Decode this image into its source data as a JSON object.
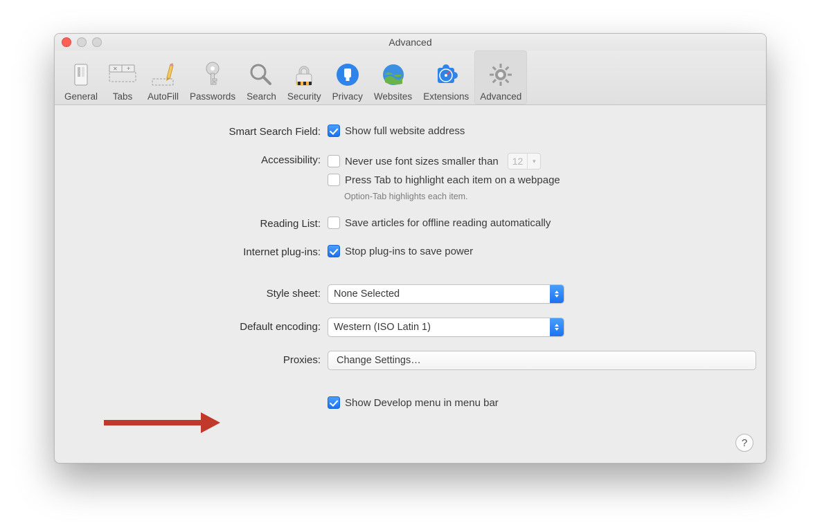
{
  "window": {
    "title": "Advanced"
  },
  "toolbar": {
    "items": [
      {
        "label": "General"
      },
      {
        "label": "Tabs"
      },
      {
        "label": "AutoFill"
      },
      {
        "label": "Passwords"
      },
      {
        "label": "Search"
      },
      {
        "label": "Security"
      },
      {
        "label": "Privacy"
      },
      {
        "label": "Websites"
      },
      {
        "label": "Extensions"
      },
      {
        "label": "Advanced"
      }
    ],
    "selected_index": 9
  },
  "sections": {
    "smart_search": {
      "label": "Smart Search Field:",
      "show_full_url": {
        "text": "Show full website address",
        "checked": true
      }
    },
    "accessibility": {
      "label": "Accessibility:",
      "min_font": {
        "text": "Never use font sizes smaller than",
        "checked": false,
        "value": "12"
      },
      "press_tab": {
        "text": "Press Tab to highlight each item on a webpage",
        "checked": false
      },
      "hint": "Option-Tab highlights each item."
    },
    "reading_list": {
      "label": "Reading List:",
      "save_offline": {
        "text": "Save articles for offline reading automatically",
        "checked": false
      }
    },
    "plugins": {
      "label": "Internet plug-ins:",
      "stop_power": {
        "text": "Stop plug-ins to save power",
        "checked": true
      }
    },
    "stylesheet": {
      "label": "Style sheet:",
      "value": "None Selected"
    },
    "encoding": {
      "label": "Default encoding:",
      "value": "Western (ISO Latin 1)"
    },
    "proxies": {
      "label": "Proxies:",
      "button": "Change Settings…"
    },
    "develop": {
      "text": "Show Develop menu in menu bar",
      "checked": true
    }
  },
  "help_label": "?"
}
